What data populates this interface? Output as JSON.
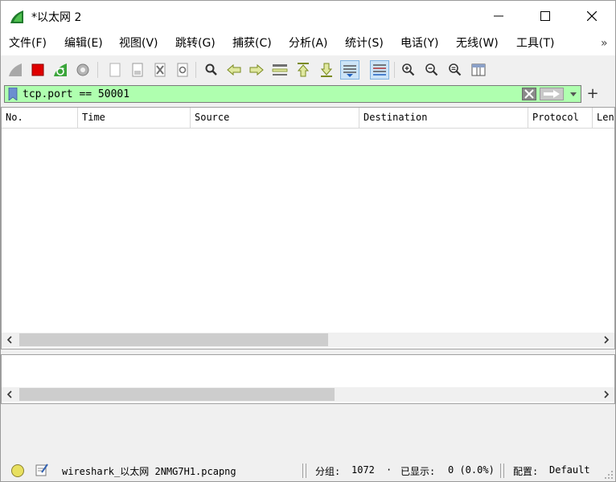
{
  "window": {
    "title": "*以太网 2"
  },
  "menu": [
    {
      "label": "文件(F)"
    },
    {
      "label": "编辑(E)"
    },
    {
      "label": "视图(V)"
    },
    {
      "label": "跳转(G)"
    },
    {
      "label": "捕获(C)"
    },
    {
      "label": "分析(A)"
    },
    {
      "label": "统计(S)"
    },
    {
      "label": "电话(Y)"
    },
    {
      "label": "无线(W)"
    },
    {
      "label": "工具(T)"
    }
  ],
  "menu_more": "»",
  "toolbar_icons": [
    "start-capture-icon",
    "stop-capture-icon",
    "restart-capture-icon",
    "capture-options-icon",
    "open-file-icon",
    "save-file-icon",
    "close-file-icon",
    "reload-file-icon",
    "find-packet-icon",
    "go-back-icon",
    "go-forward-icon",
    "go-to-packet-icon",
    "first-packet-icon",
    "last-packet-icon",
    "autoscroll-icon",
    "colorize-icon",
    "zoom-in-icon",
    "zoom-out-icon",
    "zoom-normal-icon",
    "resize-columns-icon"
  ],
  "filter": {
    "value": "tcp.port == 50001",
    "bg_color": "#afffaf"
  },
  "packet_list": {
    "columns": [
      "No.",
      "Time",
      "Source",
      "Destination",
      "Protocol",
      "Len"
    ]
  },
  "status": {
    "file": "wireshark_以太网 2NMG7H1.pcapng",
    "packets_label": "分组:",
    "packets": "1072",
    "displayed_label": "已显示:",
    "displayed": "0 (0.0%)",
    "profile_label": "配置:",
    "profile": "Default"
  }
}
